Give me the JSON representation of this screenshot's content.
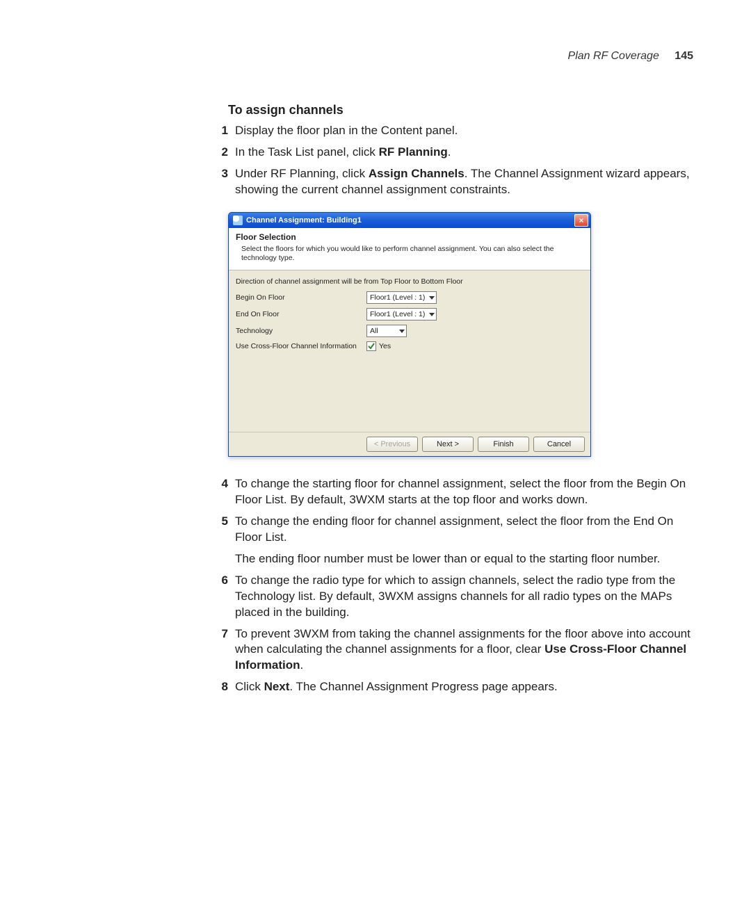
{
  "header": {
    "section": "Plan RF Coverage",
    "page_number": "145"
  },
  "title": "To assign channels",
  "steps": {
    "s1": {
      "num": "1",
      "text": "Display the floor plan in the Content panel."
    },
    "s2": {
      "num": "2",
      "pre": "In the Task List panel, click ",
      "bold": "RF Planning",
      "post": "."
    },
    "s3": {
      "num": "3",
      "pre": "Under RF Planning, click ",
      "bold": "Assign Channels",
      "post": ". The Channel Assignment wizard appears, showing the current channel assignment constraints."
    },
    "s4": {
      "num": "4",
      "text": "To change the starting floor for channel assignment, select the floor from the Begin On Floor List. By default, 3WXM starts at the top floor and works down."
    },
    "s5": {
      "num": "5",
      "text": "To change the ending floor for channel assignment, select the floor from the End On Floor List.",
      "para2": "The ending floor number must be lower than or equal to the starting floor number."
    },
    "s6": {
      "num": "6",
      "text": "To change the radio type for which to assign channels, select the radio type from the Technology list. By default, 3WXM assigns channels for all radio types on the MAPs placed in the building."
    },
    "s7": {
      "num": "7",
      "pre": "To prevent 3WXM from taking the channel assignments for the floor above into account when calculating the channel assignments for a floor, clear ",
      "bold": "Use Cross-Floor Channel Information",
      "post": "."
    },
    "s8": {
      "num": "8",
      "pre": "Click ",
      "bold": "Next",
      "post": ". The Channel Assignment Progress page appears."
    }
  },
  "dialog": {
    "title": "Channel Assignment: Building1",
    "heading": "Floor Selection",
    "description": "Select the floors for which you would like to perform channel assignment. You can also select the technology type.",
    "direction_hint": "Direction of channel assignment will be from Top Floor to Bottom Floor",
    "begin_label": "Begin On Floor",
    "begin_value": "Floor1 (Level : 1)",
    "end_label": "End On Floor",
    "end_value": "Floor1 (Level : 1)",
    "tech_label": "Technology",
    "tech_value": "All",
    "cross_label": "Use Cross-Floor Channel Information",
    "cross_checkbox_text": "Yes",
    "cross_checked": true,
    "buttons": {
      "previous": "< Previous",
      "next": "Next >",
      "finish": "Finish",
      "cancel": "Cancel"
    }
  }
}
